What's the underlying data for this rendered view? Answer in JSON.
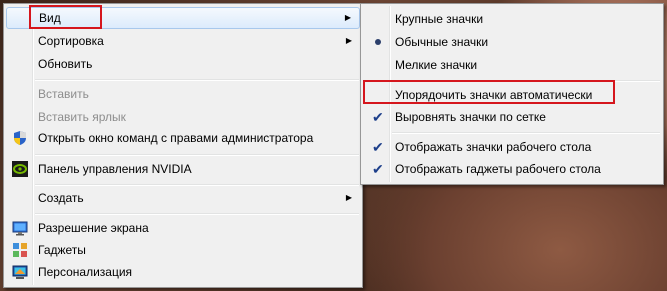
{
  "context_menu": {
    "items": [
      {
        "label": "Вид",
        "submenu": true
      },
      {
        "label": "Сортировка",
        "submenu": true
      },
      {
        "label": "Обновить"
      },
      {
        "label": "Вставить",
        "disabled": true
      },
      {
        "label": "Вставить ярлык",
        "disabled": true
      },
      {
        "label": "Открыть окно команд с правами администратора",
        "icon": "uac-shield-icon"
      },
      {
        "label": "Панель управления NVIDIA",
        "icon": "nvidia-icon"
      },
      {
        "label": "Создать",
        "submenu": true
      },
      {
        "label": "Разрешение экрана",
        "icon": "screen-resolution-icon"
      },
      {
        "label": "Гаджеты",
        "icon": "gadgets-icon"
      },
      {
        "label": "Персонализация",
        "icon": "personalization-icon"
      }
    ]
  },
  "view_submenu": {
    "items": [
      {
        "label": "Крупные значки"
      },
      {
        "label": "Обычные значки",
        "selected": true
      },
      {
        "label": "Мелкие значки"
      },
      {
        "label": "Упорядочить значки автоматически"
      },
      {
        "label": "Выровнять значки по сетке",
        "checked": true
      },
      {
        "label": "Отображать значки рабочего стола",
        "checked": true
      },
      {
        "label": "Отображать гаджеты  рабочего стола",
        "checked": true
      }
    ]
  },
  "colors": {
    "highlight_box": "#d5161d",
    "menu_background": "#f0f0f0",
    "disabled_text": "#8d8d8d"
  }
}
